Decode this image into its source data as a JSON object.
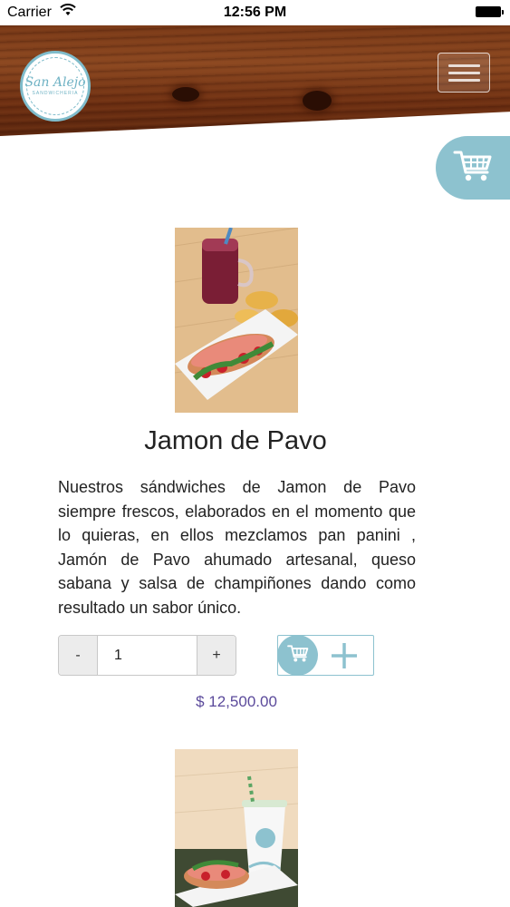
{
  "status_bar": {
    "carrier": "Carrier",
    "time": "12:56 PM"
  },
  "header": {
    "logo_text": "San Alejo",
    "logo_subtext": "SANDWICHERIA",
    "menu_icon": "hamburger-menu-icon"
  },
  "cart_fab": {
    "icon": "shopping-cart-icon",
    "color": "#8dc2cf"
  },
  "product": {
    "title": "Jamon de Pavo",
    "description": "Nuestros sándwiches de Jamon de Pavo siempre frescos, elaborados en el momento que lo quieras, en ellos mezclamos pan panini , Jamón de Pavo ahumado artesanal, queso sabana y salsa de champiñones dando como resultado un sabor único.",
    "quantity": {
      "minus_label": "-",
      "value": "1",
      "plus_label": "+"
    },
    "add_to_cart_icon": "add-to-cart-icon",
    "price": "$ 12,500.00",
    "price_color": "#5b4a9b"
  },
  "colors": {
    "accent": "#8dc2cf",
    "wood": "#7a3a18"
  }
}
